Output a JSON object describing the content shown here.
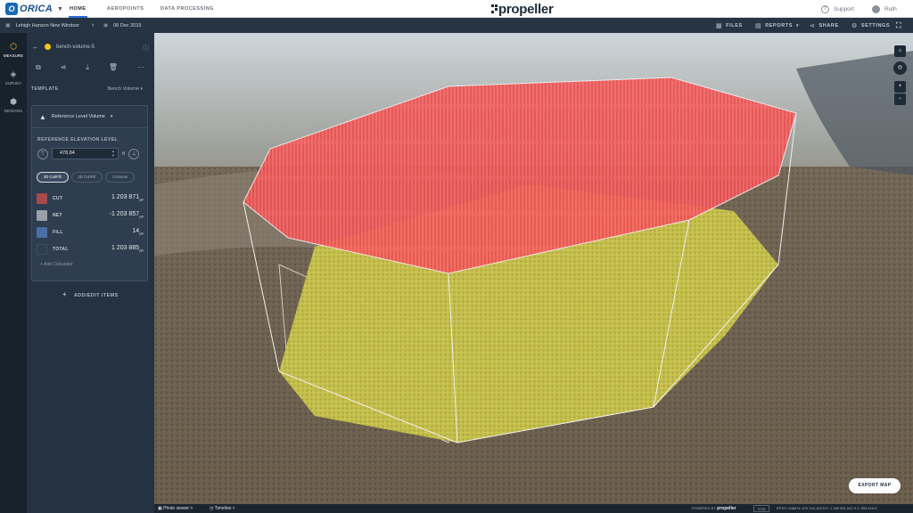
{
  "topbar": {
    "logo_text": "ORICA",
    "nav": [
      "HOME",
      "AEROPOINTS",
      "DATA PROCESSING"
    ],
    "brand": "propeller",
    "support": "Support",
    "user": "Ruth"
  },
  "subbar": {
    "site": "Lehigh Hanson New Windsor",
    "date": "06 Dec 2019",
    "files": "FILES",
    "reports": "REPORTS",
    "share": "SHARE",
    "settings": "SETTINGS"
  },
  "rail": [
    {
      "label": "MEASURE",
      "icon": "measure-icon"
    },
    {
      "label": "SURVEY",
      "icon": "layers-icon"
    },
    {
      "label": "DESIGNS",
      "icon": "cube-icon"
    }
  ],
  "panel": {
    "item_name": "bench-volume-5",
    "template_label": "TEMPLATE",
    "template_value": "Bench Volume",
    "calc_title": "Reference Level Volume",
    "ref_label": "REFERENCE ELEVATION LEVEL",
    "elevation": "478.84",
    "unit": "ft",
    "pills": [
      "3D Cut/Fill",
      "2D Cut/Fill",
      "Contours"
    ],
    "rows": [
      {
        "label": "CUT",
        "value": "1 203 871",
        "unit": "yd³",
        "color": "#a64a4a"
      },
      {
        "label": "NET",
        "value": "-1 203 857",
        "unit": "yd³",
        "color": "#9aa0a6"
      },
      {
        "label": "FILL",
        "value": "14",
        "unit": "yd³",
        "color": "#4a6fa5"
      },
      {
        "label": "TOTAL",
        "value": "1 203 885",
        "unit": "yd³",
        "color": "#2e3d4f"
      }
    ],
    "add_calc": "+ Add Calculator",
    "add_items": "ADD/EDIT ITEMS"
  },
  "map": {
    "export_label": "EXPORT MAP"
  },
  "bottombar": {
    "photo_viewer": "Photo viewer",
    "timeline": "Timeline",
    "powered": "POWERED BY",
    "brand": "propeller",
    "crs": "ECN",
    "coords": "EPSG: 6488   N: 676 144.163 ft   E: 1 280 961.642 ft   Z: 554.616 ft"
  }
}
